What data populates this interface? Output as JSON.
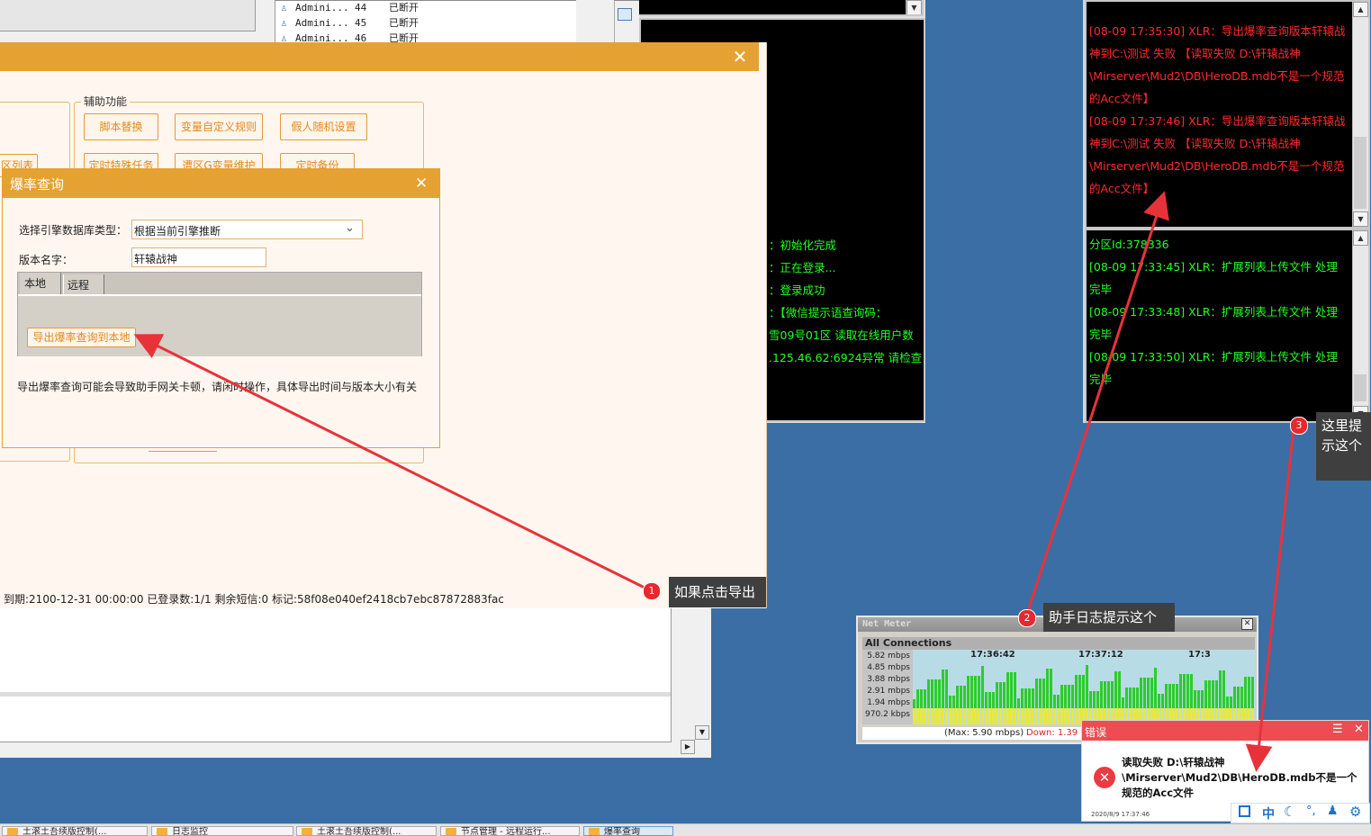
{
  "connections": [
    {
      "user": "Admini...",
      "id": "44",
      "status": "已断开"
    },
    {
      "user": "Admini...",
      "id": "45",
      "status": "已断开"
    },
    {
      "user": "Admini...",
      "id": "46",
      "status": "已断开"
    }
  ],
  "log_top": [
    "[08-09 17:35:30] XLR：导出爆率查询版本轩辕战",
    "神到C:\\测试 失败 【读取失败 D:\\轩辕战神",
    "\\Mirserver\\Mud2\\DB\\HeroDB.mdb不是一个规范",
    "的Acc文件】",
    "[08-09 17:37:46] XLR：导出爆率查询版本轩辕战",
    "神到C:\\测试 失败 【读取失败 D:\\轩辕战神",
    "\\Mirserver\\Mud2\\DB\\HeroDB.mdb不是一个规范",
    "的Acc文件】"
  ],
  "log_bottom": [
    "分区Id:378336",
    "[08-09 17:33:45] XLR：扩展列表上传文件 处理",
    "完毕",
    "[08-09 17:33:48] XLR：扩展列表上传文件 处理",
    "完毕",
    "[08-09 17:33:50] XLR：扩展列表上传文件 处理",
    "完毕"
  ],
  "log_mid": [
    "：初始化完成",
    "：正在登录...",
    "：登录成功",
    "：【微信提示语查询码：",
    "雪09号01区 读取在线用户数",
    ".125.46.62:6924异常 请检查"
  ],
  "main_dialog": {
    "group_label": "辅助功能",
    "buttons_row1": [
      "脚本替换",
      "变量自定义规则",
      "假人随机设置"
    ],
    "buttons_row2": [
      "定时特殊任务",
      "遭区G变量维护",
      "定时备份"
    ],
    "left_partial": "区列表",
    "status_bar": "到期:2100-12-31 00:00:00 已登录数:1/1 剩余短信:0 标记:58f08e040ef2418cb7ebc87872883fac"
  },
  "query_dialog": {
    "title": "爆率查询",
    "db_type_label": "选择引擎数据库类型：",
    "db_type_value": "根据当前引擎推断",
    "version_label": "版本名字：",
    "version_value": "轩辕战神",
    "tabs": [
      "本地",
      "远程"
    ],
    "export_button": "导出爆率查询到本地",
    "note": "导出爆率查询可能会导致助手网关卡顿，请闲时操作，具体导出时间与版本大小有关"
  },
  "callouts": [
    {
      "num": "1",
      "text": "如果点击导出"
    },
    {
      "num": "2",
      "text": "助手日志提示这个"
    },
    {
      "num": "3",
      "text": "这里提示这个"
    }
  ],
  "net_meter": {
    "title": "Net Meter",
    "header": "All Connections",
    "y_labels": [
      "5.82 mbps",
      "4.85 mbps",
      "3.88 mbps",
      "2.91 mbps",
      "1.94 mbps",
      "970.2 kbps"
    ],
    "time_labels": [
      "17:36:42",
      "17:37:12",
      "17:3"
    ],
    "max_text": "(Max: 5.90 mbps)",
    "down_text": "Down: 1.39"
  },
  "error_popup": {
    "title": "错误",
    "message": "读取失败 D:\\轩辕战神\\Mirserver\\Mud2\\DB\\HeroDB.mdb不是一个规范的Acc文件",
    "line1": "读取失败 D:\\轩辕战神",
    "line2": "\\Mirserver\\Mud2\\DB\\HeroDB.mdb不是一个",
    "line3": "规范的Acc文件",
    "timestamp": "2020/8/9 17:37:46"
  },
  "ime": [
    "中"
  ],
  "taskbar": [
    "土滚土吾续版控制(...",
    "日志监控",
    "土滚土吾续版控制(...",
    "节点管理 - 远程运行...",
    "爆率查询"
  ]
}
